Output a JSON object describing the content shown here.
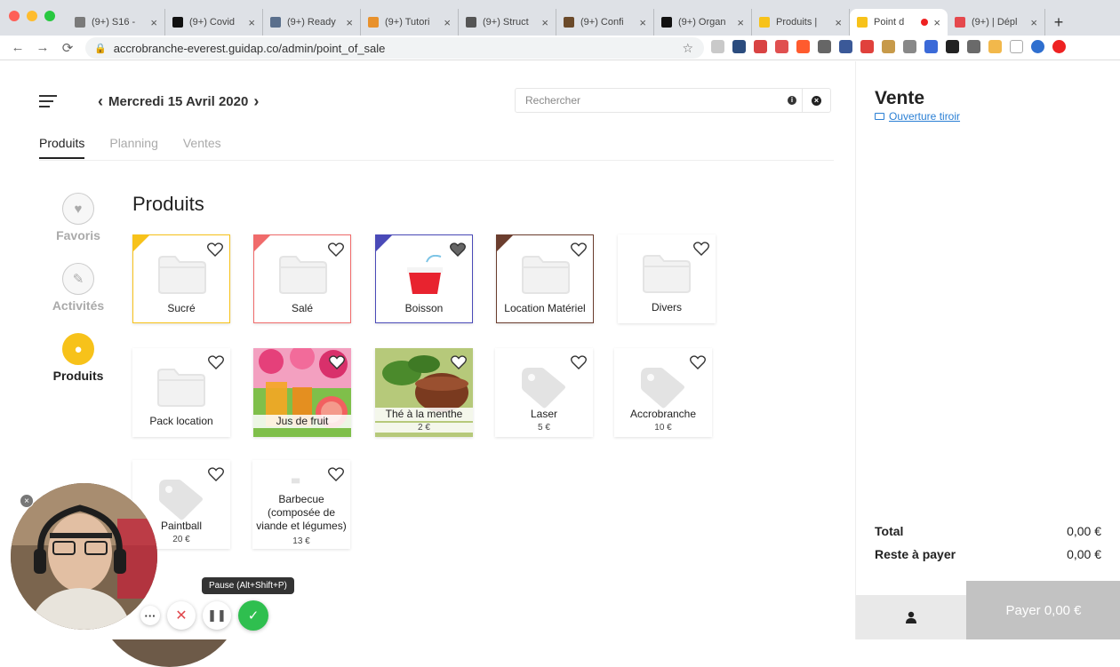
{
  "browser": {
    "tabs": [
      {
        "label": "(9+) S16 -",
        "color": "#7a7a7a"
      },
      {
        "label": "(9+) Covid",
        "color": "#111111"
      },
      {
        "label": "(9+) Ready",
        "color": "#5a6f8c"
      },
      {
        "label": "(9+) Tutori",
        "color": "#e8912c"
      },
      {
        "label": "(9+) Struct",
        "color": "#555555"
      },
      {
        "label": "(9+) Confi",
        "color": "#6b4a2a"
      },
      {
        "label": "(9+) Organ",
        "color": "#111111"
      },
      {
        "label": "Produits |",
        "color": "#f7c21a"
      },
      {
        "label": "Point d",
        "color": "#f7c21a",
        "active": true
      },
      {
        "label": "(9+) | Dépl",
        "color": "#e5484d"
      }
    ],
    "url": "accrobranche-everest.guidap.co/admin/point_of_sale"
  },
  "header": {
    "date": "Mercredi 15 Avril 2020",
    "search_placeholder": "Rechercher"
  },
  "tabs": [
    "Produits",
    "Planning",
    "Ventes"
  ],
  "sidebar": [
    {
      "label": "Favoris",
      "icon": "heart-icon",
      "glyph": "♥"
    },
    {
      "label": "Activités",
      "icon": "tag-icon",
      "glyph": "✎"
    },
    {
      "label": "Produits",
      "icon": "tag-icon",
      "glyph": "●"
    }
  ],
  "section_title": "Produits",
  "products": [
    {
      "name": "Sucré",
      "kind": "category",
      "accent": "#f7c21a",
      "border": "#f7c21a"
    },
    {
      "name": "Salé",
      "kind": "category",
      "accent": "#f06b6b",
      "border": "#f06b6b"
    },
    {
      "name": "Boisson",
      "kind": "category-image",
      "accent": "#4a4ab8",
      "border": "#4a4ab8",
      "favorited": true
    },
    {
      "name": "Location Matériel",
      "kind": "category",
      "accent": "#6b3d2e",
      "border": "#6b3d2e"
    },
    {
      "name": "Divers",
      "kind": "category"
    },
    {
      "name": "Pack location",
      "kind": "category"
    },
    {
      "name": "Jus de fruit",
      "kind": "photo-juice"
    },
    {
      "name": "Thé à la menthe",
      "kind": "photo-tea",
      "price": "2 €"
    },
    {
      "name": "Laser",
      "kind": "product",
      "price": "5 €"
    },
    {
      "name": "Accrobranche",
      "kind": "product",
      "price": "10 €"
    },
    {
      "name": "Paintball",
      "kind": "product",
      "price": "20 €"
    },
    {
      "name": "Barbecue (composée de viande et légumes)",
      "kind": "product-multi",
      "price": "13 €"
    }
  ],
  "cart": {
    "title": "Vente",
    "drawer_link": "Ouverture tiroir",
    "total_label": "Total",
    "total_value": "0,00 €",
    "remaining_label": "Reste à payer",
    "remaining_value": "0,00 €",
    "pay_button": "Payer 0,00 €"
  },
  "recorder": {
    "tooltip": "Pause (Alt+Shift+P)"
  }
}
